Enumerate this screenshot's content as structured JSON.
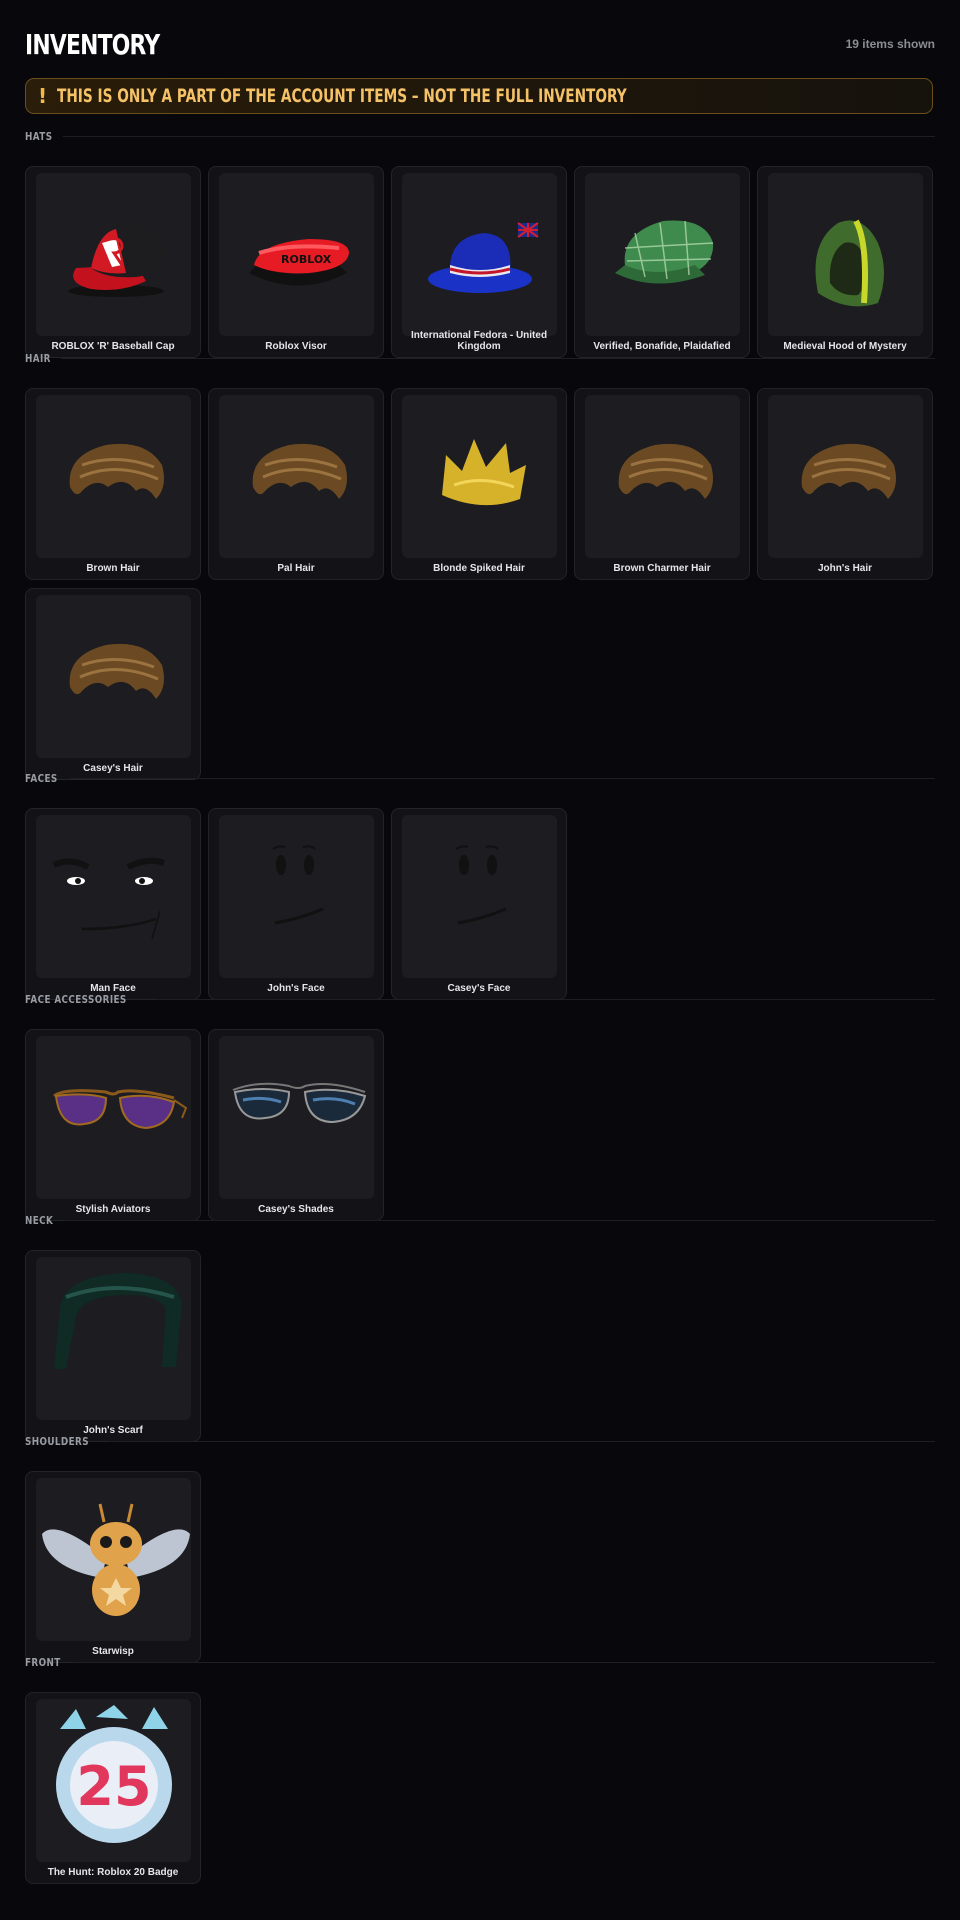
{
  "header": {
    "title": "INVENTORY",
    "count": "19 items shown"
  },
  "banner": {
    "icon": "!",
    "text": "THIS IS ONLY A PART OF THE ACCOUNT ITEMS – NOT THE FULL INVENTORY"
  },
  "sections": [
    {
      "label": "HATS",
      "items": [
        {
          "name": "ROBLOX 'R' Baseball Cap",
          "icon": "r-cap-icon"
        },
        {
          "name": "Roblox Visor",
          "icon": "visor-icon"
        },
        {
          "name": "International Fedora - United Kingdom",
          "icon": "fedora-icon"
        },
        {
          "name": "Verified, Bonafide, Plaidafied",
          "icon": "plaid-cap-icon"
        },
        {
          "name": "Medieval Hood of Mystery",
          "icon": "hood-icon"
        }
      ]
    },
    {
      "label": "HAIR",
      "items": [
        {
          "name": "Brown Hair",
          "icon": "hair-icon"
        },
        {
          "name": "Pal Hair",
          "icon": "hair-icon"
        },
        {
          "name": "Blonde Spiked Hair",
          "icon": "spiked-hair-icon"
        },
        {
          "name": "Brown Charmer Hair",
          "icon": "hair-icon"
        },
        {
          "name": "John's Hair",
          "icon": "hair-icon"
        },
        {
          "name": "Casey's Hair",
          "icon": "hair-icon"
        }
      ]
    },
    {
      "label": "FACES",
      "items": [
        {
          "name": "Man Face",
          "icon": "man-face-icon"
        },
        {
          "name": "John's Face",
          "icon": "smile-face-icon"
        },
        {
          "name": "Casey's Face",
          "icon": "smile-face-icon"
        }
      ]
    },
    {
      "label": "FACE ACCESSORIES",
      "items": [
        {
          "name": "Stylish Aviators",
          "icon": "aviators-icon"
        },
        {
          "name": "Casey's Shades",
          "icon": "shades-icon"
        }
      ]
    },
    {
      "label": "NECK",
      "items": [
        {
          "name": "John's Scarf",
          "icon": "scarf-icon"
        }
      ]
    },
    {
      "label": "SHOULDERS",
      "items": [
        {
          "name": "Starwisp",
          "icon": "starwisp-icon"
        }
      ]
    },
    {
      "label": "FRONT",
      "items": [
        {
          "name": "The Hunt: Roblox 20 Badge",
          "icon": "badge-icon",
          "badge_number": "25"
        }
      ]
    }
  ]
}
